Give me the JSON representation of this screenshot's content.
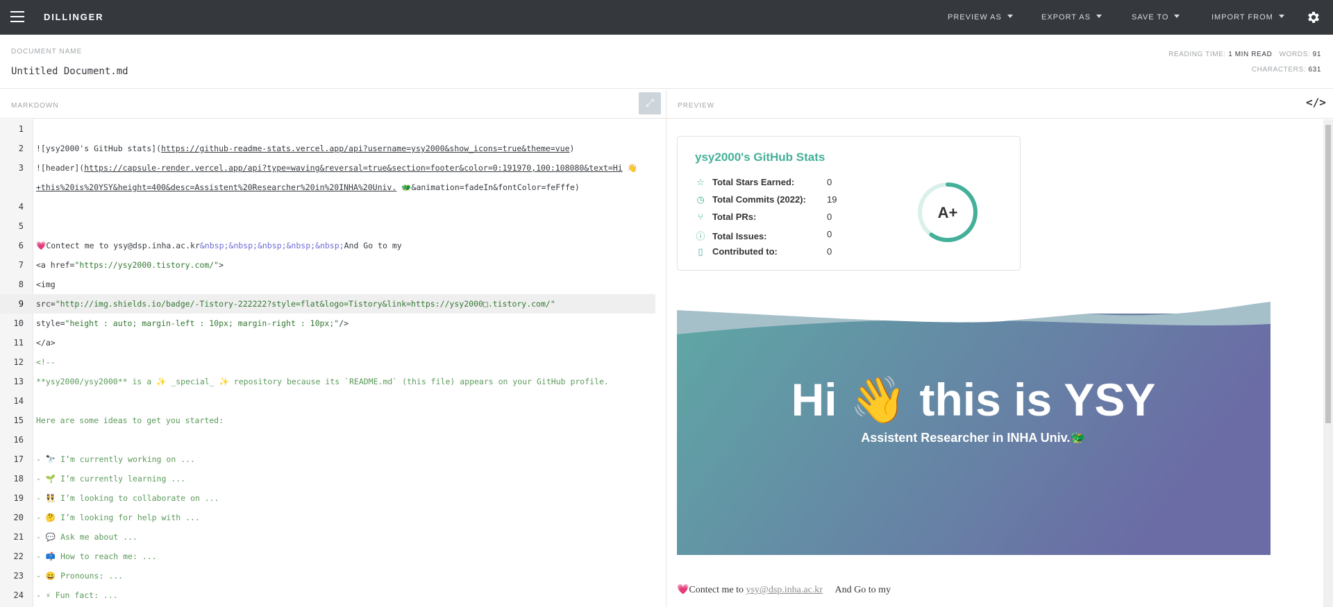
{
  "app": {
    "brand": "DILLINGER"
  },
  "menu": {
    "preview_as": "PREVIEW AS",
    "export_as": "EXPORT AS",
    "save_to": "SAVE TO",
    "import_from": "IMPORT FROM"
  },
  "document": {
    "label": "DOCUMENT NAME",
    "name": "Untitled Document.md",
    "reading_time_label": "READING TIME:",
    "reading_time": "1 MIN READ",
    "words_label": "WORDS:",
    "words": "91",
    "characters_label": "CHARACTERS:",
    "characters": "631"
  },
  "editor": {
    "label": "MARKDOWN",
    "active_line": 9,
    "lines": [
      {
        "n": "1",
        "text": ""
      },
      {
        "n": "2",
        "a": "![ysy2000's GitHub stats](",
        "u": "https://github-readme-stats.vercel.app/api?username=ysy2000&show_icons=true&theme=vue",
        "b": ")"
      },
      {
        "n": "3",
        "a": "![header](",
        "u": "https://capsule-render.vercel.app/api?type=waving&reversal=true&section=footer&color=0:191970,100:108080&text=Hi",
        "b": " 👋"
      },
      {
        "n": "",
        "a": "",
        "u": "+this%20is%20YSY&height=400&desc=Assistent%20Researcher%20in%20INHA%20Univ.",
        "b": " 🐲&animation=fadeIn&fontColor=feFffe)"
      },
      {
        "n": "4",
        "text": ""
      },
      {
        "n": "5",
        "text": ""
      },
      {
        "n": "6",
        "a": "💗Contect me to ysy@dsp.inha.ac.kr",
        "ent": "&nbsp;&nbsp;&nbsp;&nbsp;&nbsp;",
        "b": "And Go to my"
      },
      {
        "n": "7",
        "a": "<a href=",
        "str": "\"https://ysy2000.tistory.com/\"",
        "b": ">"
      },
      {
        "n": "8",
        "a": "    <img",
        "str": "",
        "b": ""
      },
      {
        "n": "9",
        "a": "        src=",
        "str": "\"http://img.shields.io/badge/-Tistory-222222?style=flat&logo=Tistory&link=https://ysy2000□.tistory.com/\"",
        "b": ""
      },
      {
        "n": "10",
        "a": "        style=",
        "str": "\"height : auto; margin-left : 10px; margin-right : 10px;\"",
        "b": "/>"
      },
      {
        "n": "11",
        "a": "</a>",
        "str": "",
        "b": ""
      },
      {
        "n": "12",
        "cm": "<!--"
      },
      {
        "n": "13",
        "cm": "**ysy2000/ysy2000** is a ✨ _special_ ✨ repository because its `README.md` (this file) appears on your GitHub profile."
      },
      {
        "n": "14",
        "text": ""
      },
      {
        "n": "15",
        "cm": "Here are some ideas to get you started:"
      },
      {
        "n": "16",
        "text": ""
      },
      {
        "n": "17",
        "cm": "- 🔭 I’m currently working on ..."
      },
      {
        "n": "18",
        "cm": "- 🌱 I’m currently learning ..."
      },
      {
        "n": "19",
        "cm": "- 👯 I’m looking to collaborate on ..."
      },
      {
        "n": "20",
        "cm": "- 🤔 I’m looking for help with ..."
      },
      {
        "n": "21",
        "cm": "- 💬 Ask me about ..."
      },
      {
        "n": "22",
        "cm": "- 📫 How to reach me: ..."
      },
      {
        "n": "23",
        "cm": "- 😄 Pronouns: ..."
      },
      {
        "n": "24",
        "cm": "- ⚡ Fun fact: ..."
      }
    ]
  },
  "preview": {
    "label": "PREVIEW",
    "stats_card": {
      "title": "ysy2000's GitHub Stats",
      "rows": [
        {
          "icon": "star-icon",
          "glyph": "☆",
          "label": "Total Stars Earned:",
          "value": "0"
        },
        {
          "icon": "history-icon",
          "glyph": "◷",
          "label": "Total Commits (2022):",
          "value": "19"
        },
        {
          "icon": "pull-request-icon",
          "glyph": "⑂",
          "label": "Total PRs:",
          "value": "0"
        },
        {
          "icon": "issue-icon",
          "glyph": "ⓘ",
          "label": "Total Issues:",
          "value": "0"
        },
        {
          "icon": "repo-icon",
          "glyph": "▯",
          "label": "Contributed to:",
          "value": "0"
        }
      ],
      "grade": "A+",
      "grade_progress": 0.6
    },
    "banner": {
      "title": "Hi 👋 this is YSY",
      "subtitle": "Assistent Researcher in INHA Univ.🐲",
      "color_start": "#108080",
      "color_end": "#191970"
    },
    "contact": {
      "prefix": "💗Contect me to ",
      "email": "ysy@dsp.inha.ac.kr",
      "suffix": "And Go to my"
    }
  }
}
